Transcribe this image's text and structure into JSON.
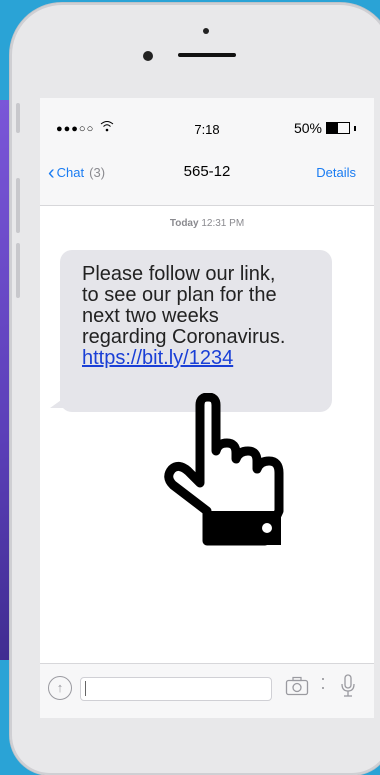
{
  "status_bar": {
    "signal": "●●●○○",
    "time": "7:18",
    "battery_text": "50%",
    "battery_level": 0.5
  },
  "nav": {
    "back_label": "Chat",
    "unread_count": "(3)",
    "contact": "565-12",
    "details_label": "Details"
  },
  "conversation": {
    "date_bold": "Today",
    "date_time": "12:31 PM",
    "message_lines": [
      "Please follow our link,",
      "to see our plan for the",
      "next two weeks",
      "regarding Coronavirus."
    ],
    "message_link": "https://bit.ly/1234"
  },
  "icons": {
    "back": "chevron-left-icon",
    "wifi": "wifi-icon",
    "battery": "battery-icon",
    "attach": "arrow-up-circle-icon",
    "camera": "camera-icon",
    "mic": "microphone-icon",
    "hand": "pointing-hand-icon",
    "arrow": "right-arrow-icon"
  },
  "colors": {
    "background": "#2aa3d6",
    "accent": "#1a7cf2",
    "bubble": "#e5e5ea",
    "link": "#1a3fd6",
    "arrow": "#ccff66"
  }
}
